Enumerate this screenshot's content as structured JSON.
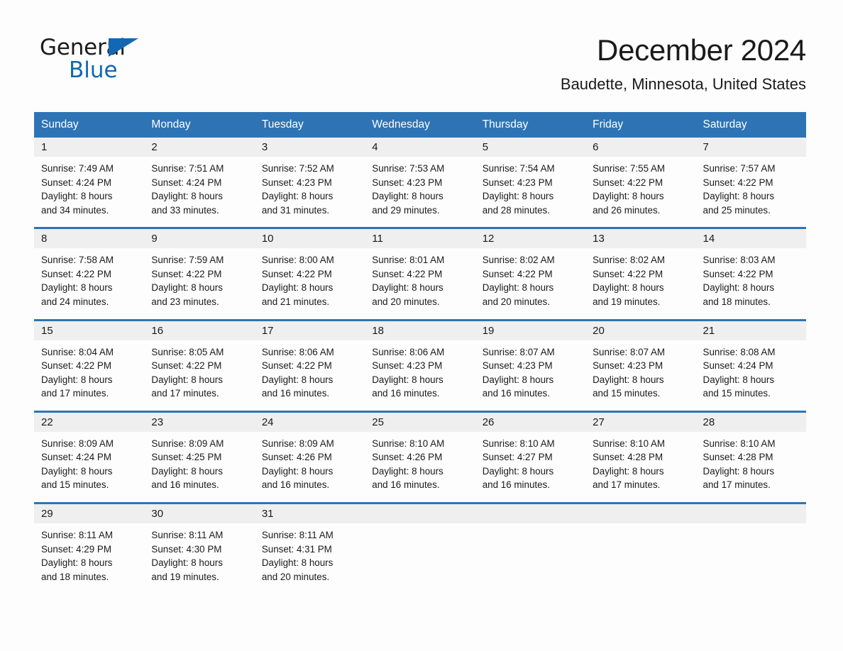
{
  "brand": {
    "name_part1": "General",
    "name_part2": "Blue"
  },
  "header": {
    "month_title": "December 2024",
    "location": "Baudette, Minnesota, United States"
  },
  "colors": {
    "header_blue": "#2e74b5",
    "logo_blue": "#1268b3",
    "daynum_band": "#efefef",
    "page_background": "#fdfdfd"
  },
  "weekday_headers": [
    "Sunday",
    "Monday",
    "Tuesday",
    "Wednesday",
    "Thursday",
    "Friday",
    "Saturday"
  ],
  "weeks": [
    {
      "daynums": [
        "1",
        "2",
        "3",
        "4",
        "5",
        "6",
        "7"
      ],
      "cells": [
        {
          "sunrise": "Sunrise: 7:49 AM",
          "sunset": "Sunset: 4:24 PM",
          "daylight_line1": "Daylight: 8 hours",
          "daylight_line2": "and 34 minutes."
        },
        {
          "sunrise": "Sunrise: 7:51 AM",
          "sunset": "Sunset: 4:24 PM",
          "daylight_line1": "Daylight: 8 hours",
          "daylight_line2": "and 33 minutes."
        },
        {
          "sunrise": "Sunrise: 7:52 AM",
          "sunset": "Sunset: 4:23 PM",
          "daylight_line1": "Daylight: 8 hours",
          "daylight_line2": "and 31 minutes."
        },
        {
          "sunrise": "Sunrise: 7:53 AM",
          "sunset": "Sunset: 4:23 PM",
          "daylight_line1": "Daylight: 8 hours",
          "daylight_line2": "and 29 minutes."
        },
        {
          "sunrise": "Sunrise: 7:54 AM",
          "sunset": "Sunset: 4:23 PM",
          "daylight_line1": "Daylight: 8 hours",
          "daylight_line2": "and 28 minutes."
        },
        {
          "sunrise": "Sunrise: 7:55 AM",
          "sunset": "Sunset: 4:22 PM",
          "daylight_line1": "Daylight: 8 hours",
          "daylight_line2": "and 26 minutes."
        },
        {
          "sunrise": "Sunrise: 7:57 AM",
          "sunset": "Sunset: 4:22 PM",
          "daylight_line1": "Daylight: 8 hours",
          "daylight_line2": "and 25 minutes."
        }
      ]
    },
    {
      "daynums": [
        "8",
        "9",
        "10",
        "11",
        "12",
        "13",
        "14"
      ],
      "cells": [
        {
          "sunrise": "Sunrise: 7:58 AM",
          "sunset": "Sunset: 4:22 PM",
          "daylight_line1": "Daylight: 8 hours",
          "daylight_line2": "and 24 minutes."
        },
        {
          "sunrise": "Sunrise: 7:59 AM",
          "sunset": "Sunset: 4:22 PM",
          "daylight_line1": "Daylight: 8 hours",
          "daylight_line2": "and 23 minutes."
        },
        {
          "sunrise": "Sunrise: 8:00 AM",
          "sunset": "Sunset: 4:22 PM",
          "daylight_line1": "Daylight: 8 hours",
          "daylight_line2": "and 21 minutes."
        },
        {
          "sunrise": "Sunrise: 8:01 AM",
          "sunset": "Sunset: 4:22 PM",
          "daylight_line1": "Daylight: 8 hours",
          "daylight_line2": "and 20 minutes."
        },
        {
          "sunrise": "Sunrise: 8:02 AM",
          "sunset": "Sunset: 4:22 PM",
          "daylight_line1": "Daylight: 8 hours",
          "daylight_line2": "and 20 minutes."
        },
        {
          "sunrise": "Sunrise: 8:02 AM",
          "sunset": "Sunset: 4:22 PM",
          "daylight_line1": "Daylight: 8 hours",
          "daylight_line2": "and 19 minutes."
        },
        {
          "sunrise": "Sunrise: 8:03 AM",
          "sunset": "Sunset: 4:22 PM",
          "daylight_line1": "Daylight: 8 hours",
          "daylight_line2": "and 18 minutes."
        }
      ]
    },
    {
      "daynums": [
        "15",
        "16",
        "17",
        "18",
        "19",
        "20",
        "21"
      ],
      "cells": [
        {
          "sunrise": "Sunrise: 8:04 AM",
          "sunset": "Sunset: 4:22 PM",
          "daylight_line1": "Daylight: 8 hours",
          "daylight_line2": "and 17 minutes."
        },
        {
          "sunrise": "Sunrise: 8:05 AM",
          "sunset": "Sunset: 4:22 PM",
          "daylight_line1": "Daylight: 8 hours",
          "daylight_line2": "and 17 minutes."
        },
        {
          "sunrise": "Sunrise: 8:06 AM",
          "sunset": "Sunset: 4:22 PM",
          "daylight_line1": "Daylight: 8 hours",
          "daylight_line2": "and 16 minutes."
        },
        {
          "sunrise": "Sunrise: 8:06 AM",
          "sunset": "Sunset: 4:23 PM",
          "daylight_line1": "Daylight: 8 hours",
          "daylight_line2": "and 16 minutes."
        },
        {
          "sunrise": "Sunrise: 8:07 AM",
          "sunset": "Sunset: 4:23 PM",
          "daylight_line1": "Daylight: 8 hours",
          "daylight_line2": "and 16 minutes."
        },
        {
          "sunrise": "Sunrise: 8:07 AM",
          "sunset": "Sunset: 4:23 PM",
          "daylight_line1": "Daylight: 8 hours",
          "daylight_line2": "and 15 minutes."
        },
        {
          "sunrise": "Sunrise: 8:08 AM",
          "sunset": "Sunset: 4:24 PM",
          "daylight_line1": "Daylight: 8 hours",
          "daylight_line2": "and 15 minutes."
        }
      ]
    },
    {
      "daynums": [
        "22",
        "23",
        "24",
        "25",
        "26",
        "27",
        "28"
      ],
      "cells": [
        {
          "sunrise": "Sunrise: 8:09 AM",
          "sunset": "Sunset: 4:24 PM",
          "daylight_line1": "Daylight: 8 hours",
          "daylight_line2": "and 15 minutes."
        },
        {
          "sunrise": "Sunrise: 8:09 AM",
          "sunset": "Sunset: 4:25 PM",
          "daylight_line1": "Daylight: 8 hours",
          "daylight_line2": "and 16 minutes."
        },
        {
          "sunrise": "Sunrise: 8:09 AM",
          "sunset": "Sunset: 4:26 PM",
          "daylight_line1": "Daylight: 8 hours",
          "daylight_line2": "and 16 minutes."
        },
        {
          "sunrise": "Sunrise: 8:10 AM",
          "sunset": "Sunset: 4:26 PM",
          "daylight_line1": "Daylight: 8 hours",
          "daylight_line2": "and 16 minutes."
        },
        {
          "sunrise": "Sunrise: 8:10 AM",
          "sunset": "Sunset: 4:27 PM",
          "daylight_line1": "Daylight: 8 hours",
          "daylight_line2": "and 16 minutes."
        },
        {
          "sunrise": "Sunrise: 8:10 AM",
          "sunset": "Sunset: 4:28 PM",
          "daylight_line1": "Daylight: 8 hours",
          "daylight_line2": "and 17 minutes."
        },
        {
          "sunrise": "Sunrise: 8:10 AM",
          "sunset": "Sunset: 4:28 PM",
          "daylight_line1": "Daylight: 8 hours",
          "daylight_line2": "and 17 minutes."
        }
      ]
    },
    {
      "daynums": [
        "29",
        "30",
        "31",
        "",
        "",
        "",
        ""
      ],
      "cells": [
        {
          "sunrise": "Sunrise: 8:11 AM",
          "sunset": "Sunset: 4:29 PM",
          "daylight_line1": "Daylight: 8 hours",
          "daylight_line2": "and 18 minutes."
        },
        {
          "sunrise": "Sunrise: 8:11 AM",
          "sunset": "Sunset: 4:30 PM",
          "daylight_line1": "Daylight: 8 hours",
          "daylight_line2": "and 19 minutes."
        },
        {
          "sunrise": "Sunrise: 8:11 AM",
          "sunset": "Sunset: 4:31 PM",
          "daylight_line1": "Daylight: 8 hours",
          "daylight_line2": "and 20 minutes."
        },
        {
          "sunrise": "",
          "sunset": "",
          "daylight_line1": "",
          "daylight_line2": ""
        },
        {
          "sunrise": "",
          "sunset": "",
          "daylight_line1": "",
          "daylight_line2": ""
        },
        {
          "sunrise": "",
          "sunset": "",
          "daylight_line1": "",
          "daylight_line2": ""
        },
        {
          "sunrise": "",
          "sunset": "",
          "daylight_line1": "",
          "daylight_line2": ""
        }
      ]
    }
  ]
}
